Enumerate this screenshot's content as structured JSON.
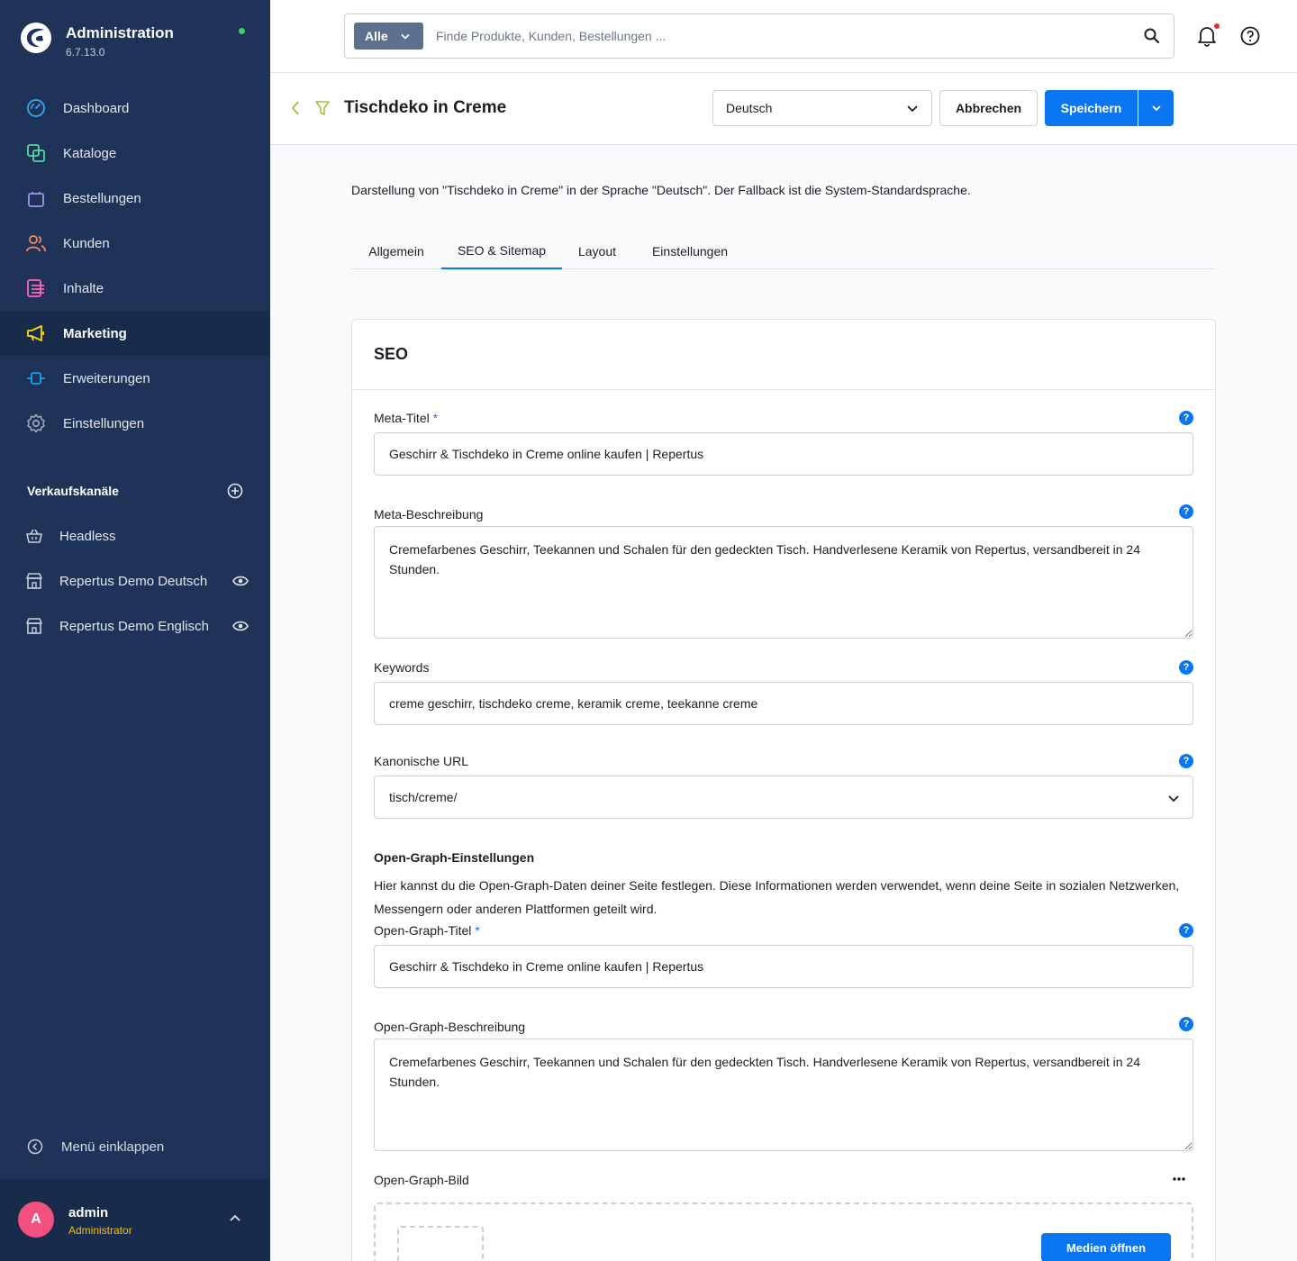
{
  "app": {
    "title": "Administration",
    "version": "6.7.13.0",
    "status_color": "#37d46b"
  },
  "nav": {
    "items": [
      {
        "label": "Dashboard",
        "icon": "dashboard-icon",
        "color": "#3aa7ef"
      },
      {
        "label": "Kataloge",
        "icon": "catalog-icon",
        "color": "#57d9a3"
      },
      {
        "label": "Bestellungen",
        "icon": "shopping-bag-icon",
        "color": "#a092f0"
      },
      {
        "label": "Kunden",
        "icon": "customers-icon",
        "color": "#f88962"
      },
      {
        "label": "Inhalte",
        "icon": "content-icon",
        "color": "#ff68b4"
      },
      {
        "label": "Marketing",
        "icon": "megaphone-icon",
        "color": "#ffd700",
        "active": true
      },
      {
        "label": "Erweiterungen",
        "icon": "extensions-icon",
        "color": "#189eff"
      },
      {
        "label": "Einstellungen",
        "icon": "gear-icon",
        "color": "#9aa8b5"
      }
    ]
  },
  "sales_channels": {
    "title": "Verkaufskanäle",
    "items": [
      {
        "label": "Headless",
        "icon": "basket-icon"
      },
      {
        "label": "Repertus Demo Deutsch",
        "icon": "storefront-icon"
      },
      {
        "label": "Repertus Demo Englisch",
        "icon": "storefront-icon"
      }
    ]
  },
  "collapse_label": "Menü einklappen",
  "user": {
    "initial": "A",
    "name": "admin",
    "role": "Administrator"
  },
  "search": {
    "filter_label": "Alle",
    "placeholder": "Finde Produkte, Kunden, Bestellungen ..."
  },
  "header": {
    "title": "Tischdeko in Creme",
    "language": "Deutsch",
    "cancel_label": "Abbrechen",
    "save_label": "Speichern"
  },
  "info_text": "Darstellung von \"Tischdeko in Creme\" in der Sprache \"Deutsch\". Der Fallback ist die System-Standardsprache.",
  "tabs": [
    {
      "label": "Allgemein"
    },
    {
      "label": "SEO & Sitemap",
      "active": true
    },
    {
      "label": "Layout"
    },
    {
      "label": "Einstellungen"
    }
  ],
  "seo": {
    "title": "SEO",
    "meta_title_label": "Meta-Titel",
    "required_marker": "*",
    "meta_title_value": "Geschirr & Tischdeko in Creme online kaufen | Repertus",
    "meta_description_label": "Meta-Beschreibung",
    "meta_description_value": "Cremefarbenes Geschirr, Teekannen und Schalen für den gedeckten Tisch. Handverlesene Keramik von Repertus, versandbereit in 24 Stunden.",
    "keywords_label": "Keywords",
    "keywords_value": "creme geschirr, tischdeko creme, keramik creme, teekanne creme",
    "canonical_label": "Kanonische URL",
    "canonical_value": "tisch/creme/",
    "og_heading": "Open-Graph-Einstellungen",
    "og_description_text": "Hier kannst du die Open-Graph-Daten deiner Seite festlegen. Diese Informationen werden verwendet, wenn deine Seite in sozialen Netzwerken, Messengern oder anderen Plattformen geteilt wird.",
    "og_title_label": "Open-Graph-Titel",
    "og_title_value": "Geschirr & Tischdeko in Creme online kaufen | Repertus",
    "og_desc_label": "Open-Graph-Beschreibung",
    "og_desc_value": "Cremefarbenes Geschirr, Teekannen und Schalen für den gedeckten Tisch. Handverlesene Keramik von Repertus, versandbereit in 24 Stunden.",
    "og_image_label": "Open-Graph-Bild",
    "open_media_label": "Medien öffnen",
    "help_glyph": "?"
  },
  "colors": {
    "accent": "#0b76f2",
    "sidebar": "#1f3358",
    "sidebar_active": "#192b4a"
  }
}
